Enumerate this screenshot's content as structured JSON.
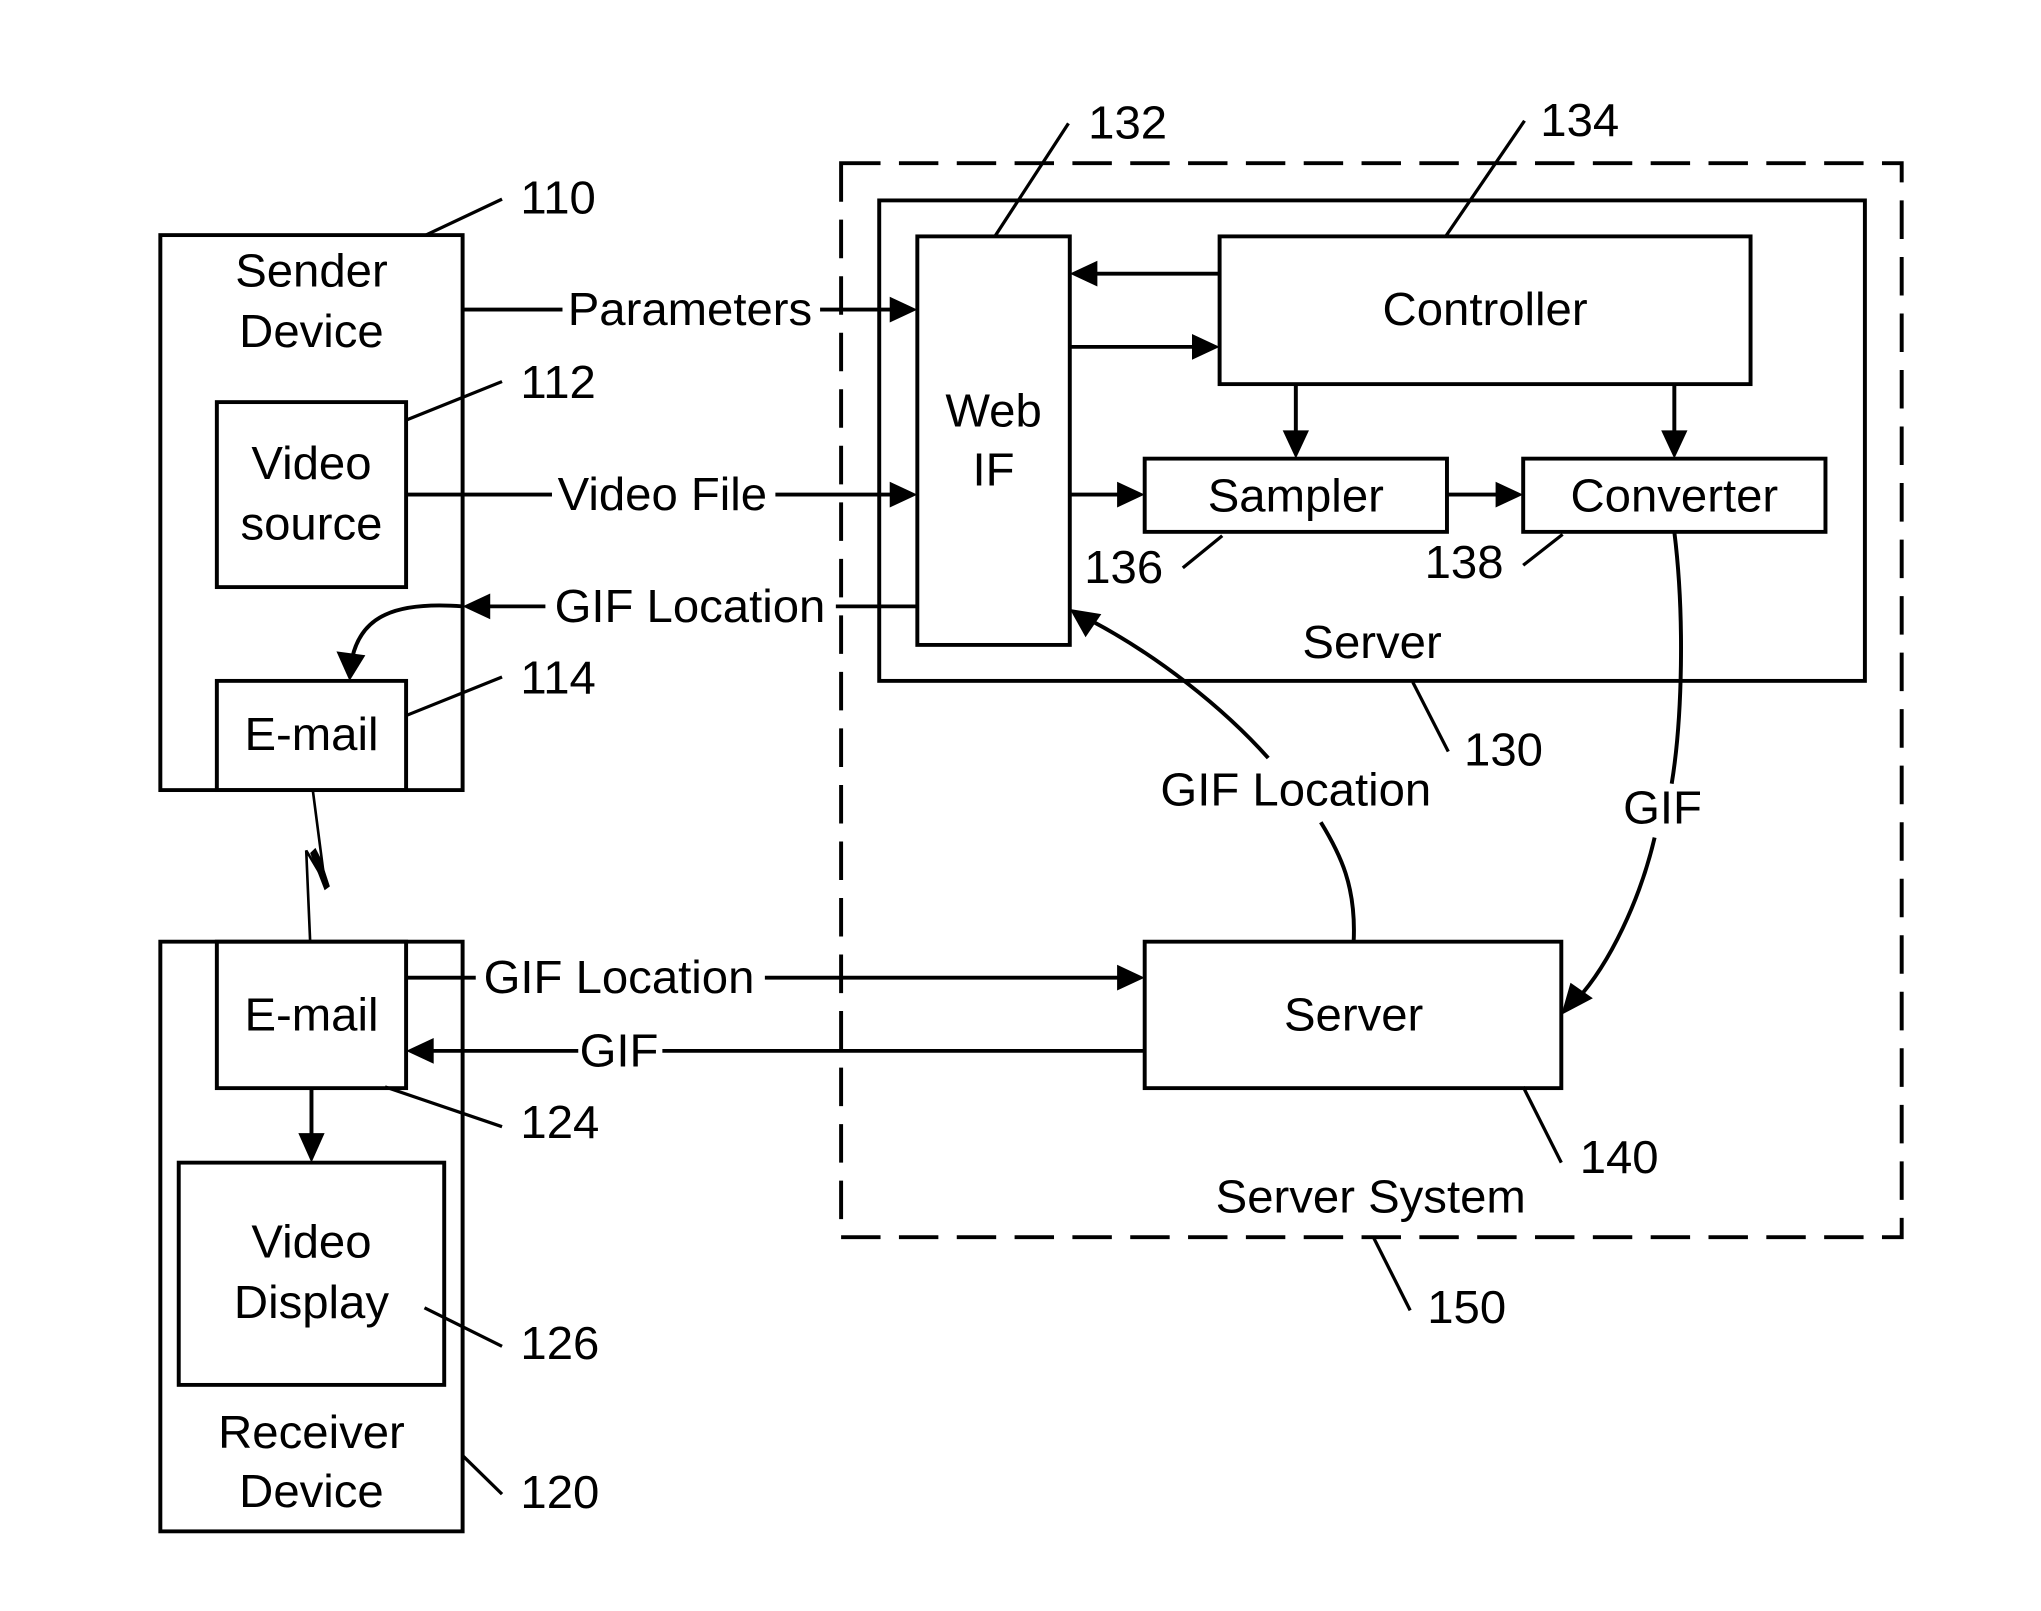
{
  "diagram": {
    "type": "block-diagram",
    "colors": {
      "line": "#000000",
      "background": "#ffffff"
    },
    "blocks": {
      "sender_device": {
        "label_line1": "Sender",
        "label_line2": "Device",
        "ref": "110"
      },
      "video_source": {
        "label_line1": "Video",
        "label_line2": "source",
        "ref": "112"
      },
      "sender_email": {
        "label": "E-mail",
        "ref": "114"
      },
      "receiver_device": {
        "label_line1": "Receiver",
        "label_line2": "Device",
        "ref": "120"
      },
      "receiver_email": {
        "label": "E-mail",
        "ref": "124"
      },
      "video_display": {
        "label_line1": "Video",
        "label_line2": "Display",
        "ref": "126"
      },
      "server_130": {
        "label": "Server",
        "ref": "130"
      },
      "web_if": {
        "label_line1": "Web",
        "label_line2": "IF",
        "ref": "132"
      },
      "controller": {
        "label": "Controller",
        "ref": "134"
      },
      "sampler": {
        "label": "Sampler",
        "ref": "136"
      },
      "converter": {
        "label": "Converter",
        "ref": "138"
      },
      "server_140": {
        "label": "Server",
        "ref": "140"
      },
      "server_system": {
        "label": "Server System",
        "ref": "150"
      }
    },
    "flows": {
      "parameters": "Parameters",
      "video_file": "Video File",
      "gif_location_to_sender": "GIF Location",
      "gif_location_to_webif": "GIF Location",
      "gif_from_converter": "GIF",
      "gif_location_to_server": "GIF Location",
      "gif_to_receiver": "GIF"
    }
  }
}
